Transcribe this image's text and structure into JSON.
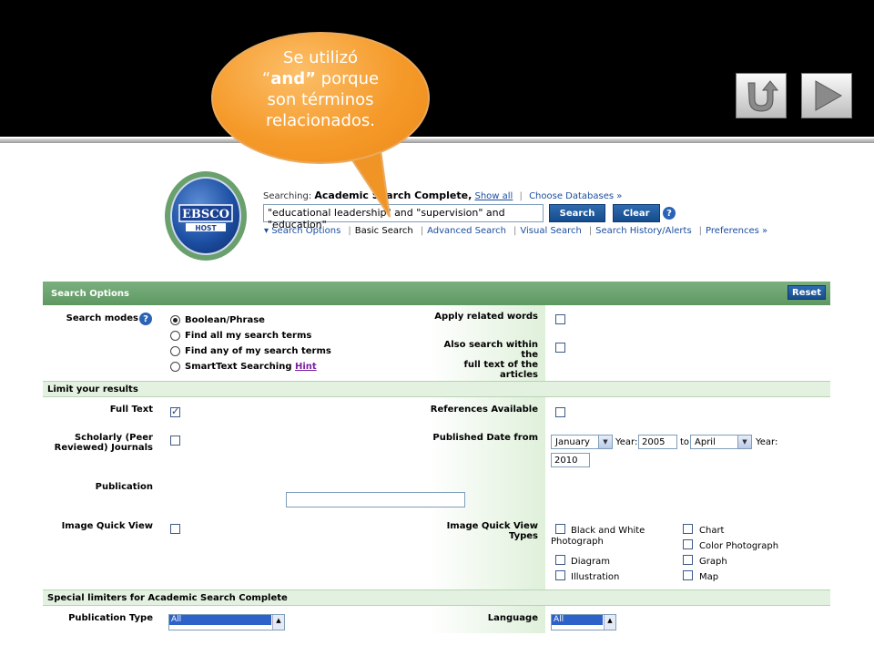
{
  "slide": {
    "bubble": {
      "line1": "Se utilizó",
      "quote_open": "“",
      "keyword": "and”",
      "line2_rest": " porque",
      "line3": "son términos",
      "line4": "relacionados."
    },
    "nav_buttons": [
      "return-icon",
      "play-next-icon"
    ],
    "colors": {
      "band": "#000000",
      "bubble": "#f59a2a"
    }
  },
  "header": {
    "logo_text_top": "EBSCO",
    "logo_text_bottom": "HOST",
    "searching_label": "Searching:",
    "database": "Academic Search Complete,",
    "show_all": "Show all",
    "choose_databases": "Choose Databases »",
    "query": "\"educational leadership\" and \"supervision\" and \"education\"",
    "search_btn": "Search",
    "clear_btn": "Clear",
    "help": "?",
    "links": {
      "search_options": "▾ Search Options",
      "basic": "Basic Search",
      "advanced": "Advanced Search",
      "visual": "Visual Search",
      "history": "Search History/Alerts",
      "preferences": "Preferences »"
    }
  },
  "search_options": {
    "title": "Search Options",
    "reset": "Reset",
    "modes_label": "Search modes",
    "modes": [
      "Boolean/Phrase",
      "Find all my search terms",
      "Find any of my search terms",
      "SmartText Searching"
    ],
    "hint": "Hint",
    "selected_mode_index": 0,
    "apply_related": "Apply related words",
    "also_search_1": "Also search within the",
    "also_search_2": "full text of the articles"
  },
  "limits": {
    "title": "Limit your results",
    "full_text": "Full Text",
    "full_text_checked": true,
    "references": "References Available",
    "scholarly_1": "Scholarly (Peer",
    "scholarly_2": "Reviewed) Journals",
    "published_date": "Published Date from",
    "month_from": "January",
    "year_label": "Year:",
    "year_from": "2005",
    "to": "to",
    "month_to": "April",
    "year_to": "2010",
    "publication": "Publication",
    "iqv": "Image Quick View",
    "iqv_types": "Image Quick View Types",
    "types": {
      "bw_1": "Black and White",
      "bw_2": "Photograph",
      "chart": "Chart",
      "color": "Color Photograph",
      "diagram": "Diagram",
      "graph": "Graph",
      "illustration": "Illustration",
      "map": "Map"
    }
  },
  "special": {
    "title": "Special limiters for Academic Search Complete",
    "pub_type": "Publication Type",
    "pub_type_value": "All",
    "language": "Language",
    "language_value": "All"
  }
}
